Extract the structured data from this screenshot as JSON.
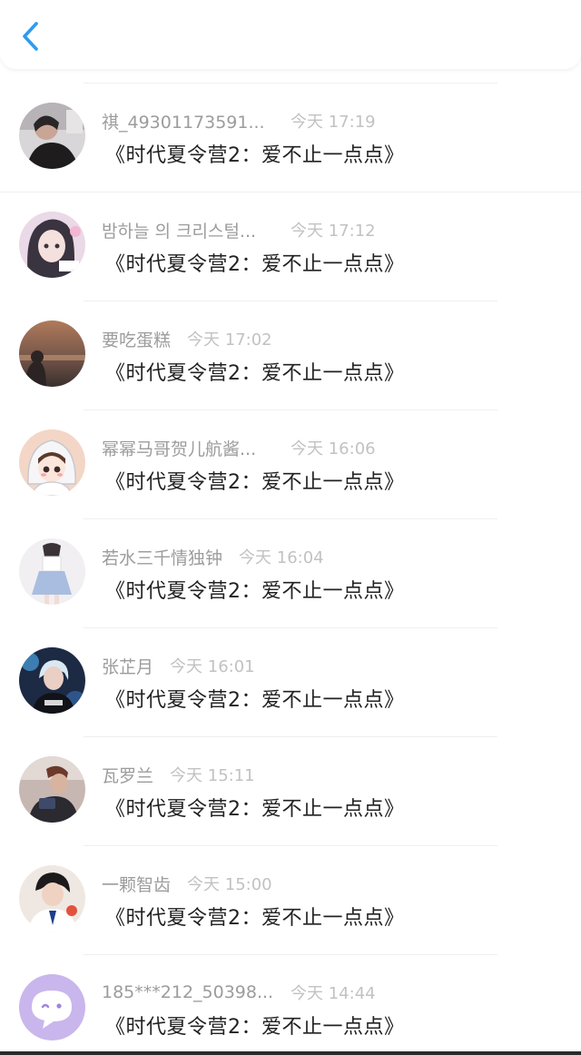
{
  "header": {
    "back_icon": "chevron-left-icon",
    "accent_color": "#2d9bf0"
  },
  "items": [
    {
      "name": "祺_49301173591...",
      "time": "今天 17:19",
      "title": "《时代夏令营2：爱不止一点点》",
      "long": true
    },
    {
      "name": "밤하늘 의 크리스털...",
      "time": "今天 17:12",
      "title": "《时代夏令营2：爱不止一点点》",
      "long": true
    },
    {
      "name": "要吃蛋糕",
      "time": "今天 17:02",
      "title": "《时代夏令营2：爱不止一点点》",
      "long": false
    },
    {
      "name": "幂幂马哥贺儿航酱...",
      "time": "今天 16:06",
      "title": "《时代夏令营2：爱不止一点点》",
      "long": true
    },
    {
      "name": "若水三千情独钟",
      "time": "今天 16:04",
      "title": "《时代夏令营2：爱不止一点点》",
      "long": false
    },
    {
      "name": "张芷月",
      "time": "今天 16:01",
      "title": "《时代夏令营2：爱不止一点点》",
      "long": false
    },
    {
      "name": "瓦罗兰",
      "time": "今天 15:11",
      "title": "《时代夏令营2：爱不止一点点》",
      "long": false
    },
    {
      "name": "一颗智齿",
      "time": "今天 15:00",
      "title": "《时代夏令营2：爱不止一点点》",
      "long": false
    },
    {
      "name": "185***212_50398...",
      "time": "今天 14:44",
      "title": "《时代夏令营2：爱不止一点点》",
      "long": true
    }
  ]
}
